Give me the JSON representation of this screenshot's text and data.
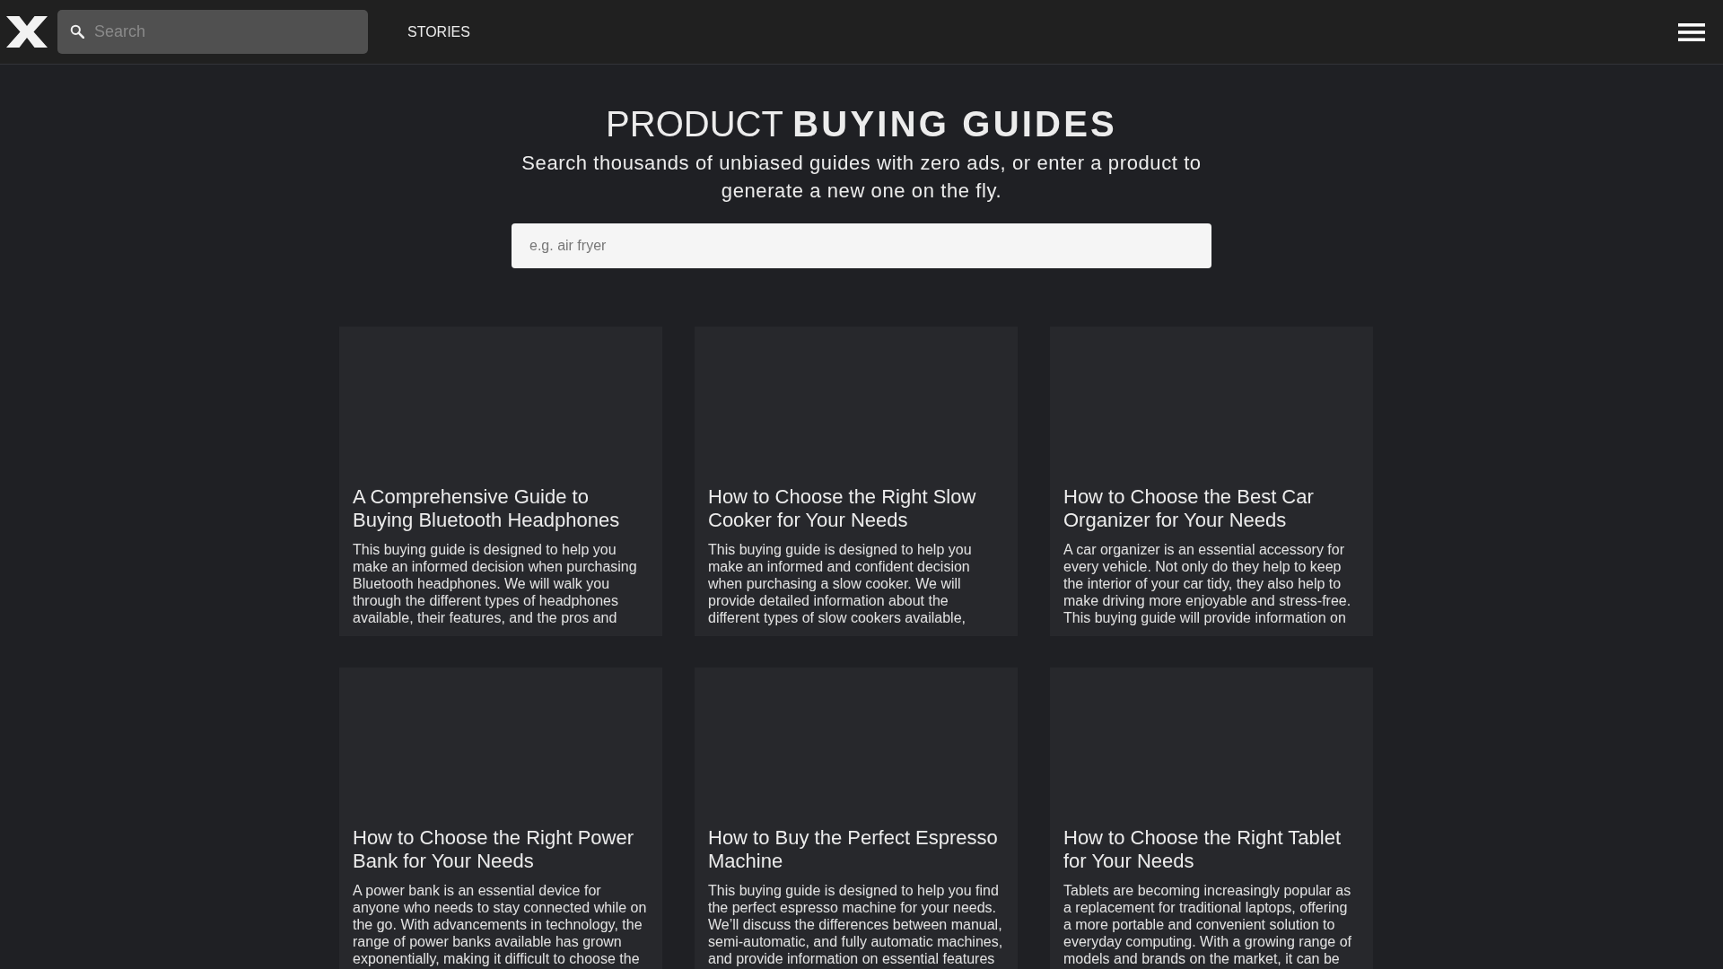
{
  "header": {
    "search": {
      "placeholder": "Search"
    },
    "nav": [
      {
        "label": "STORIES"
      }
    ]
  },
  "hero": {
    "title": "PRODUCT **BUYING GUIDES**",
    "subtitle": "Search thousands of unbiased guides with zero ads, or enter a product to generate a new one on the fly.",
    "search": {
      "placeholder": "e.g. air fryer"
    }
  },
  "guides": [
    {
      "title": "A Comprehensive Guide to Buying Bluetooth Headphones",
      "description": "This buying guide is designed to help you make an informed decision when purchasing Bluetooth headphones. We will walk you through the different types of headphones available, their features, and the pros and"
    },
    {
      "title": "How to Choose the Right Slow Cooker for Your Needs",
      "description": "This buying guide is designed to help you make an informed and confident decision when purchasing a slow cooker. We will provide detailed information about the different types of slow cookers available,"
    },
    {
      "title": "How to Choose the Best Car Organizer for Your Needs",
      "description": "A car organizer is an essential accessory for every vehicle. Not only do they help to keep the interior of your car tidy, they also help to make driving more enjoyable and stress-free. This buying guide will provide information on"
    },
    {
      "title": "How to Choose the Right Power Bank for Your Needs",
      "description": "A power bank is an essential device for anyone who needs to stay connected while on the go. With advancements in technology, the range of power banks available has grown exponentially, making it difficult to choose the"
    },
    {
      "title": "How to Buy the Perfect Espresso Machine",
      "description": "This buying guide is designed to help you find the perfect espresso machine for your needs. We’ll discuss the differences between manual, semi-automatic, and fully automatic machines, and provide information on essential features"
    },
    {
      "title": "How to Choose the Right Tablet for Your Needs",
      "description": "Tablets are becoming increasingly popular as a replacement for traditional laptops, offering a more portable and convenient solution to everyday computing. With a growing range of models and brands on the market, it can be"
    }
  ]
}
